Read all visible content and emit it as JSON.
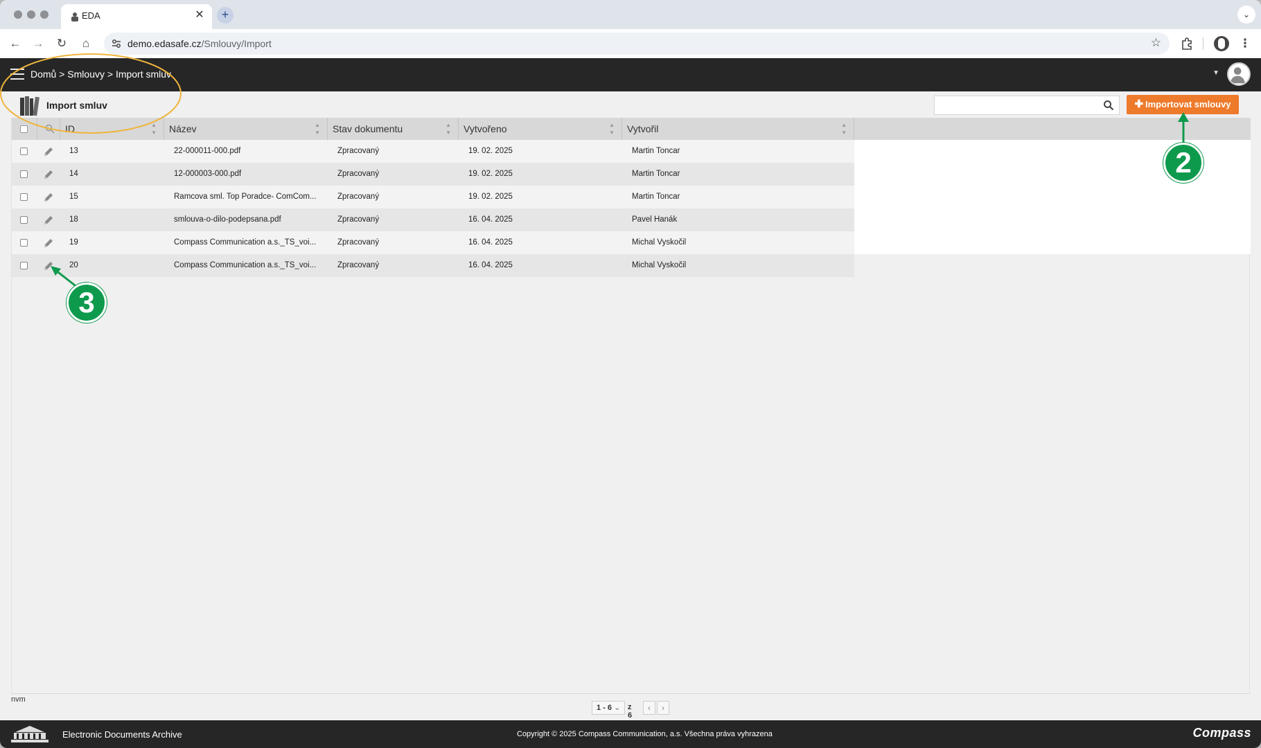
{
  "browser": {
    "tab_title": "EDA",
    "url_host": "demo.edasafe.cz",
    "url_path": "/Smlouvy/Import"
  },
  "app": {
    "breadcrumb": "Domů > Smlouvy > Import smluv",
    "page_title": "Import smluv",
    "search_placeholder": "",
    "import_button_label": "Importovat smlouvy",
    "accent_color": "#ee7a2b"
  },
  "table": {
    "columns": [
      "ID",
      "Název",
      "Stav dokumentu",
      "Vytvořeno",
      "Vytvořil"
    ],
    "rows": [
      {
        "id": "13",
        "name": "22-000011-000.pdf",
        "status": "Zpracovaný",
        "created": "19. 02. 2025",
        "author": "Martin Toncar"
      },
      {
        "id": "14",
        "name": "12-000003-000.pdf",
        "status": "Zpracovaný",
        "created": "19. 02. 2025",
        "author": "Martin Toncar"
      },
      {
        "id": "15",
        "name": "Ramcova sml. Top Poradce- ComCom...",
        "status": "Zpracovaný",
        "created": "19. 02. 2025",
        "author": "Martin Toncar"
      },
      {
        "id": "18",
        "name": "smlouva-o-dilo-podepsana.pdf",
        "status": "Zpracovaný",
        "created": "16. 04. 2025",
        "author": "Pavel Hanák"
      },
      {
        "id": "19",
        "name": "Compass Communication a.s._TS_voi...",
        "status": "Zpracovaný",
        "created": "16. 04. 2025",
        "author": "Michal Vyskočil"
      },
      {
        "id": "20",
        "name": "Compass Communication a.s._TS_voi...",
        "status": "Zpracovaný",
        "created": "16. 04. 2025",
        "author": "Michal Vyskočil"
      }
    ]
  },
  "pager": {
    "range": "1 - 6",
    "of": "z 6"
  },
  "status_text": "nvm",
  "footer": {
    "title": "Electronic Documents Archive",
    "copyright": "Copyright © 2025 Compass Communication, a.s. Všechna práva vyhrazena",
    "brand": "Compass"
  },
  "annotations": {
    "badge_2": "2",
    "badge_3": "3",
    "badge_color": "#0e9a4d",
    "highlight_color": "#f0b43c"
  }
}
